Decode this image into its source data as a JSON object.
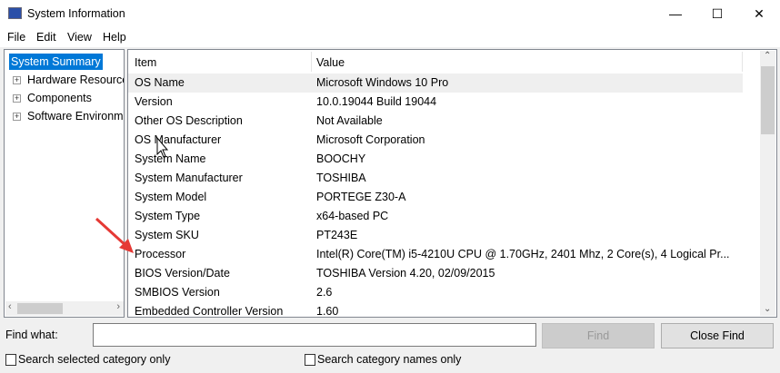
{
  "window": {
    "title": "System Information",
    "minimize": "—",
    "maximize": "☐",
    "close": "✕"
  },
  "menu": [
    "File",
    "Edit",
    "View",
    "Help"
  ],
  "tree": [
    {
      "label": "System Summary",
      "selected": true
    },
    {
      "label": "Hardware Resources"
    },
    {
      "label": "Components"
    },
    {
      "label": "Software Environment"
    }
  ],
  "table": {
    "headers": [
      "Item",
      "Value"
    ],
    "rows": [
      [
        "OS Name",
        "Microsoft Windows 10 Pro"
      ],
      [
        "Version",
        "10.0.19044 Build 19044"
      ],
      [
        "Other OS Description",
        "Not Available"
      ],
      [
        "OS Manufacturer",
        "Microsoft Corporation"
      ],
      [
        "System Name",
        "BOOCHY"
      ],
      [
        "System Manufacturer",
        "TOSHIBA"
      ],
      [
        "System Model",
        "PORTEGE Z30-A"
      ],
      [
        "System Type",
        "x64-based PC"
      ],
      [
        "System SKU",
        "PT243E"
      ],
      [
        "Processor",
        "Intel(R) Core(TM) i5-4210U CPU @ 1.70GHz, 2401 Mhz, 2 Core(s), 4 Logical Pr..."
      ],
      [
        "BIOS Version/Date",
        "TOSHIBA Version 4.20, 02/09/2015"
      ],
      [
        "SMBIOS Version",
        "2.6"
      ],
      [
        "Embedded Controller Version",
        "1.60"
      ]
    ]
  },
  "find": {
    "label": "Find what:",
    "value": "",
    "find_button": "Find",
    "close_button": "Close Find",
    "chk_selected": "Search selected category only",
    "chk_names": "Search category names only"
  },
  "colors": {
    "selection": "#0078d7",
    "annotation_arrow": "#e53935"
  }
}
